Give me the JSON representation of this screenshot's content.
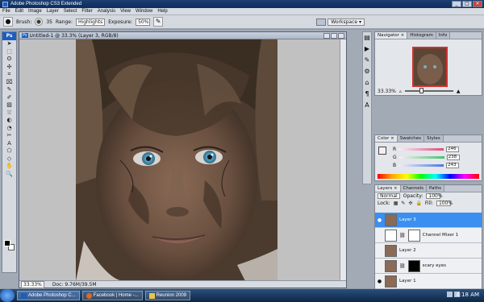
{
  "window": {
    "title": "Adobe Photoshop CS3 Extended",
    "min": "_",
    "max": "□",
    "close": "×"
  },
  "menu": [
    "File",
    "Edit",
    "Image",
    "Layer",
    "Select",
    "Filter",
    "Analysis",
    "View",
    "Window",
    "Help"
  ],
  "options": {
    "brush_label": "Brush:",
    "brush_size": "35",
    "range_label": "Range:",
    "range_value": "Highlights",
    "exposure_label": "Exposure:",
    "exposure_value": "50%",
    "workspace_label": "Workspace ▾"
  },
  "tools": {
    "logo": "Ps",
    "icons": [
      "➤",
      "⬚",
      "ʘ",
      "✣",
      "⌗",
      "⌧",
      "✎",
      "✐",
      "▨",
      "⛆",
      "◐",
      "◔",
      "✂",
      "A",
      "⬠",
      "◇",
      "✋",
      "🔍"
    ]
  },
  "document": {
    "title": "Untitled-1 @ 33.3% (Layer 3, RGB/8)",
    "badge": "Ps",
    "zoom": "33.33%",
    "doc_info": "Doc: 9.76M/39.5M"
  },
  "navigator": {
    "tabs": [
      "Navigator ×",
      "Histogram",
      "Info"
    ],
    "zoom": "33.33%"
  },
  "color": {
    "tabs": [
      "Color ×",
      "Swatches",
      "Styles"
    ],
    "channels": [
      {
        "label": "R",
        "value": "246",
        "color": "#e04a7a"
      },
      {
        "label": "G",
        "value": "238",
        "color": "#47c26b"
      },
      {
        "label": "B",
        "value": "243",
        "color": "#4a78e0"
      }
    ]
  },
  "layers": {
    "tabs": [
      "Layers ×",
      "Channels",
      "Paths"
    ],
    "blend_mode": "Normal",
    "opacity_label": "Opacity:",
    "opacity_value": "100%",
    "lock_label": "Lock:",
    "fill_label": "Fill:",
    "fill_value": "100%",
    "items": [
      {
        "name": "Layer 3",
        "visible": true,
        "selected": true,
        "kind": "pixel"
      },
      {
        "name": "Channel Mixer 1",
        "visible": false,
        "selected": false,
        "kind": "adjust"
      },
      {
        "name": "Layer 2",
        "visible": false,
        "selected": false,
        "kind": "pixel"
      },
      {
        "name": "scary eyes",
        "visible": false,
        "selected": false,
        "kind": "masked"
      },
      {
        "name": "Layer 1",
        "visible": true,
        "selected": false,
        "kind": "pixel"
      }
    ],
    "footer_icons": [
      "⛓",
      "fx",
      "◐",
      "●",
      "▣",
      "❏",
      "🗑"
    ]
  },
  "taskbar": {
    "tasks": [
      "Adobe Photoshop C...",
      "Facebook | Home -...",
      "Reunion 2009"
    ],
    "clock": "4:18 AM"
  },
  "colors": {
    "selected_layer": "#3a8ff0",
    "brand": "#1b5ec2"
  }
}
